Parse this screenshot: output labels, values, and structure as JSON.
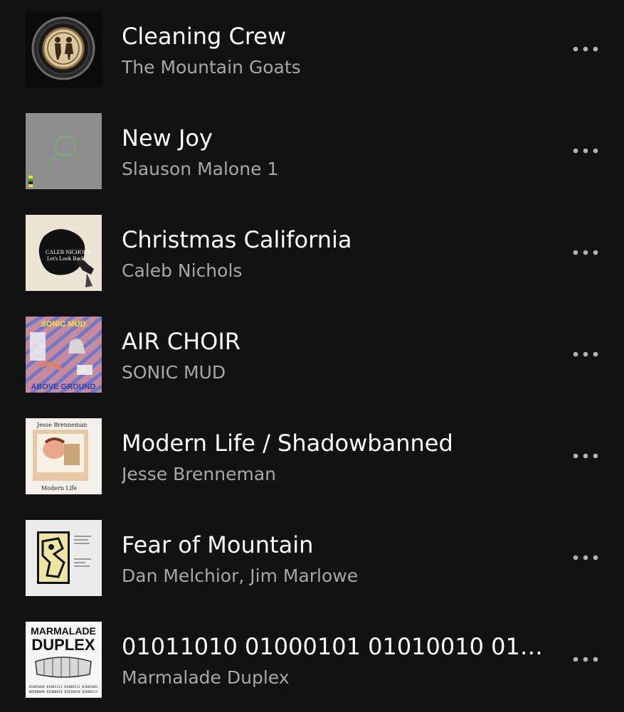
{
  "tracks": [
    {
      "title": "Cleaning Crew",
      "artist": "The Mountain Goats",
      "more_icon": "more-horizontal-icon"
    },
    {
      "title": "New Joy",
      "artist": "Slauson Malone 1",
      "more_icon": "more-horizontal-icon"
    },
    {
      "title": "Christmas California",
      "artist": "Caleb Nichols",
      "more_icon": "more-horizontal-icon"
    },
    {
      "title": "AIR CHOIR",
      "artist": "SONIC MUD",
      "more_icon": "more-horizontal-icon"
    },
    {
      "title": "Modern Life / Shadowbanned",
      "artist": "Jesse Brenneman",
      "more_icon": "more-horizontal-icon"
    },
    {
      "title": "Fear of Mountain",
      "artist": "Dan Melchior, Jim Marlowe",
      "more_icon": "more-horizontal-icon"
    },
    {
      "title": "01011010 01000101 01010010 0100…",
      "artist": "Marmalade Duplex",
      "more_icon": "more-horizontal-icon"
    }
  ],
  "covers": {
    "caleb": {
      "line1": "CALEB NICHOLS",
      "line2": "Let's Look Back"
    },
    "sonic": {
      "top": "SONIC MUD",
      "bottom": "ABOVE GROUND"
    },
    "jesse": {
      "top": "Jesse Brenneman",
      "bottom": "Modern Life"
    },
    "marmalade": {
      "line1": "MARMALADE",
      "line2": "DUPLEX",
      "binary1": "01001000 01001111 01000111 01001001",
      "binary2": "00100000 01000010 01010010 01000111"
    }
  },
  "colors": {
    "background": "#121212",
    "title": "#ffffff",
    "artist": "#a7a7a7",
    "icon": "#b3b3b3"
  }
}
